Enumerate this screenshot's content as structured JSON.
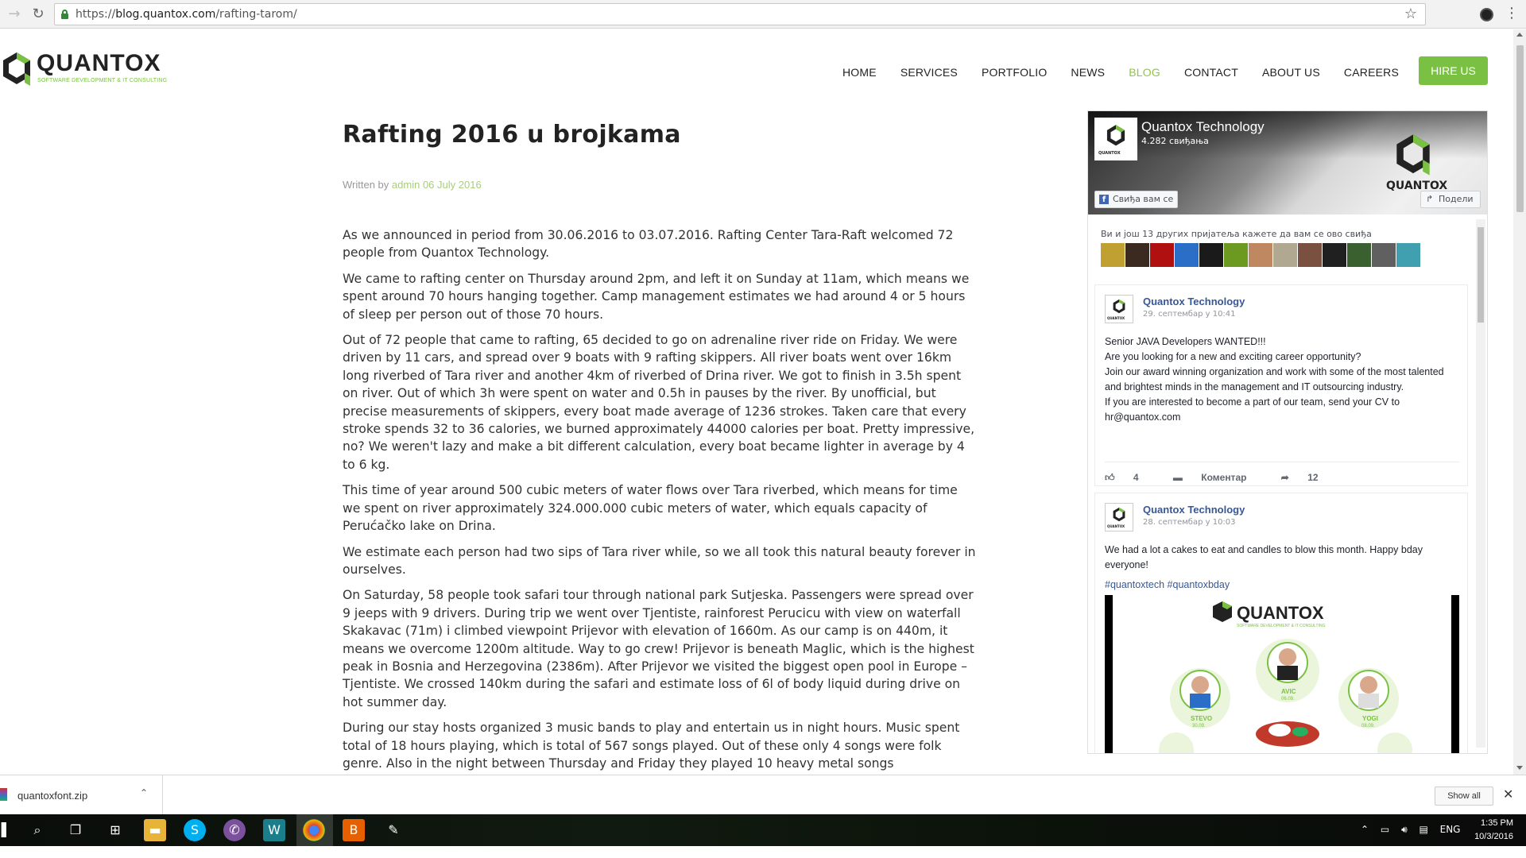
{
  "browser": {
    "url_scheme": "https://",
    "url_host": "blog.quantox.com",
    "url_path": "/rafting-tarom/"
  },
  "site": {
    "logo_word": "QUANTOX",
    "logo_tagline": "SOFTWARE DEVELOPMENT & IT CONSULTING",
    "brand_green": "#7ac143",
    "nav": [
      "HOME",
      "SERVICES",
      "PORTFOLIO",
      "NEWS",
      "BLOG",
      "CONTACT",
      "ABOUT US",
      "CAREERS"
    ],
    "nav_active": "BLOG",
    "hire_label": "HIRE US"
  },
  "article": {
    "title": "Rafting 2016 u brojkama",
    "meta_prefix": "Written by",
    "author": "admin",
    "date": "06 July 2016",
    "paragraphs": [
      "As we announced in period from 30.06.2016 to 03.07.2016. Rafting Center Tara-Raft welcomed 72 people from Quantox Technology.",
      "We came to rafting center on Thursday around 2pm, and left it on Sunday at 11am, which means we spent around 70 hours hanging together. Camp management estimates we had around 4 or 5 hours of sleep per person out of those 70 hours.",
      "Out of 72 people that came to rafting, 65 decided to go on adrenaline river ride on Friday. We were driven by 11 cars, and spread over 9 boats with 9 rafting skippers. All river boats went over 16km long riverbed of Tara river and another 4km of riverbed of Drina river. We got to finish in 3.5h spent on river. Out of which 3h were spent on water and 0.5h in pauses by the river. By unofficial, but precise measurements of skippers, every boat made average of 1236 strokes. Taken care that every stroke spends 32 to 36 calories, we burned approximately 44000 calories per boat. Pretty impressive, no? We weren't lazy and make a bit different calculation, every boat became lighter in average by 4 to 6 kg.",
      "This time of year around 500 cubic meters of water flows over Tara riverbed, which means for time we spent on river approximately 324.000.000 cubic meters of water, which equals capacity of Perućačko lake on Drina.",
      "We estimate each person had two sips of Tara river while, so we all took this natural beauty forever in ourselves.",
      "On Saturday, 58 people took safari tour through national park Sutjeska. Passengers were spread over 9 jeeps with 9 drivers. During trip we went over Tjentiste, rainforest Perucicu with view on waterfall Skakavac (71m) i climbed viewpoint Prijevor with elevation of 1660m. As our camp is on 440m, it means we overcome 1200m altitude. Way to go crew! Prijevor is beneath Maglic, which is the highest peak in Bosnia and Herzegovina (2386m). After Prijevor we visited the biggest open pool in Europe – Tjentiste. We crossed 140km during the safari and estimate loss of 6l of body liquid during drive on hot summer day.",
      "During our stay hosts organized 3 music bands to play and entertain us in night hours. Music spent total of 18 hours playing, which is total of 567 songs played. Out of these only 4 songs were folk genre. Also in the night between Thursday and Friday they played 10 heavy metal songs"
    ]
  },
  "facebook": {
    "page_name": "Quantox Technology",
    "likes": "4.282 свиђања",
    "like_button": "Свиђа вам се",
    "share_button": "Подели",
    "avatar_caption": "QUANTOX",
    "cover_word": "QUANTOX",
    "friends_text": "Ви и још 13 других пријатеља кажете да вам се ово свиђа",
    "face_colors": [
      "#c0a030",
      "#3a2a20",
      "#b01010",
      "#2a6ec8",
      "#1a1a1a",
      "#6c9a20",
      "#c08860",
      "#b0a890",
      "#7a5040",
      "#202020",
      "#3a6030",
      "#606060",
      "#40a0b0"
    ],
    "posts": [
      {
        "author": "Quantox Technology",
        "time": "29. септембар у 10:41",
        "lines": [
          "Senior JAVA Developers WANTED!!!",
          "Are you looking for a new and exciting career opportunity?",
          "Join our award winning organization and work with some of the most talented and brightest minds in the management and IT outsourcing industry.",
          "If you are interested to become a part of our team, send your CV to hr@quantox.com"
        ],
        "likes": "4",
        "comment_label": "Коментар",
        "shares": "12"
      },
      {
        "author": "Quantox Technology",
        "time": "28. септембар у 10:03",
        "text": "We had a lot a cakes to eat and candles to blow this month. Happy bday everyone!",
        "hashtags": "#quantoxtech #quantoxbday",
        "image_brand": "QUANTOX",
        "image_tagline": "SOFTWARE DEVELOPMENT & IT CONSULTING",
        "people": [
          {
            "name": "AVIC",
            "date": "06.09."
          },
          {
            "name": "STEVO",
            "date": "30.09."
          },
          {
            "name": "YOGI",
            "date": "08.09."
          }
        ]
      }
    ]
  },
  "downloads": {
    "file_name": "quantoxfont.zip",
    "show_all": "Show all"
  },
  "taskbar": {
    "lang": "ENG",
    "time": "1:35 PM",
    "date": "10/3/2016"
  }
}
